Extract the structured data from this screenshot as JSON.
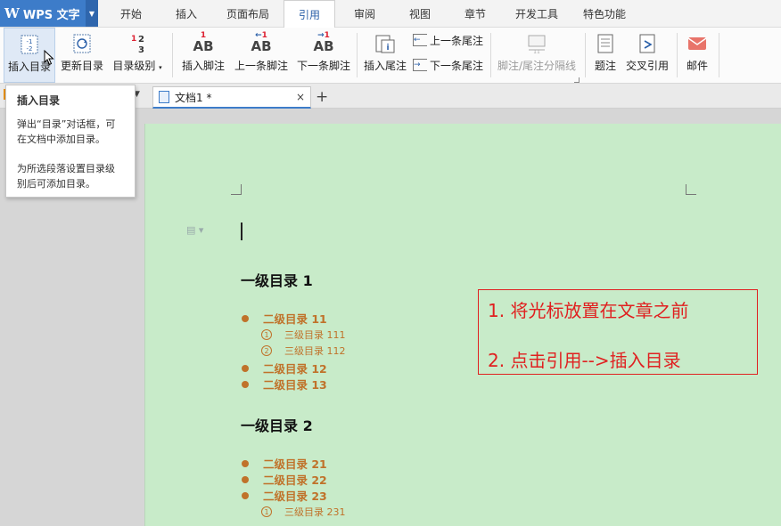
{
  "app": {
    "name": "WPS 文字",
    "logo": "W"
  },
  "menu": {
    "tabs": [
      {
        "label": "开始"
      },
      {
        "label": "插入"
      },
      {
        "label": "页面布局"
      },
      {
        "label": "引用",
        "active": true
      },
      {
        "label": "审阅"
      },
      {
        "label": "视图"
      },
      {
        "label": "章节"
      },
      {
        "label": "开发工具"
      },
      {
        "label": "特色功能"
      }
    ]
  },
  "ribbon": {
    "insert_toc": "插入目录",
    "update_toc": "更新目录",
    "toc_level": "目录级别",
    "insert_footnote": "插入脚注",
    "prev_footnote": "上一条脚注",
    "next_footnote": "下一条脚注",
    "insert_endnote": "插入尾注",
    "prev_endnote": "上一条尾注",
    "next_endnote": "下一条尾注",
    "separator_line": "脚注/尾注分隔线",
    "caption": "题注",
    "cross_ref": "交叉引用",
    "mail": "邮件"
  },
  "tooltip": {
    "title": "插入目录",
    "desc1": "弹出“目录”对话框，可在文档中添加目录。",
    "desc2": "为所选段落设置目录级别后可添加目录。"
  },
  "doc_tab": {
    "title": "文档1 *",
    "close": "×",
    "new": "+"
  },
  "document": {
    "sections": [
      {
        "heading": "一级目录 1",
        "items": [
          {
            "level": 2,
            "text": "二级目录 11"
          },
          {
            "level": 3,
            "num": "1",
            "text": "三级目录 111"
          },
          {
            "level": 3,
            "num": "2",
            "text": "三级目录 112"
          },
          {
            "level": 2,
            "text": "二级目录 12"
          },
          {
            "level": 2,
            "text": "二级目录 13"
          }
        ]
      },
      {
        "heading": "一级目录 2",
        "items": [
          {
            "level": 2,
            "text": "二级目录 21"
          },
          {
            "level": 2,
            "text": "二级目录 22"
          },
          {
            "level": 2,
            "text": "二级目录 23"
          },
          {
            "level": 3,
            "num": "1",
            "text": "三级目录 231"
          }
        ]
      }
    ]
  },
  "callout": {
    "step1": "1. 将光标放置在文章之前",
    "step2": "2. 点击引用-->插入目录"
  },
  "colors": {
    "accent": "#3d7cc9",
    "page": "#c8ebc9",
    "toc_orange": "#c0722a",
    "callout_red": "#e02020"
  },
  "icons": [
    "insert-toc-icon",
    "update-toc-icon",
    "toc-level-icon",
    "footnote-icon",
    "endnote-icon",
    "separator-icon",
    "caption-icon",
    "cross-ref-icon",
    "mail-icon"
  ]
}
